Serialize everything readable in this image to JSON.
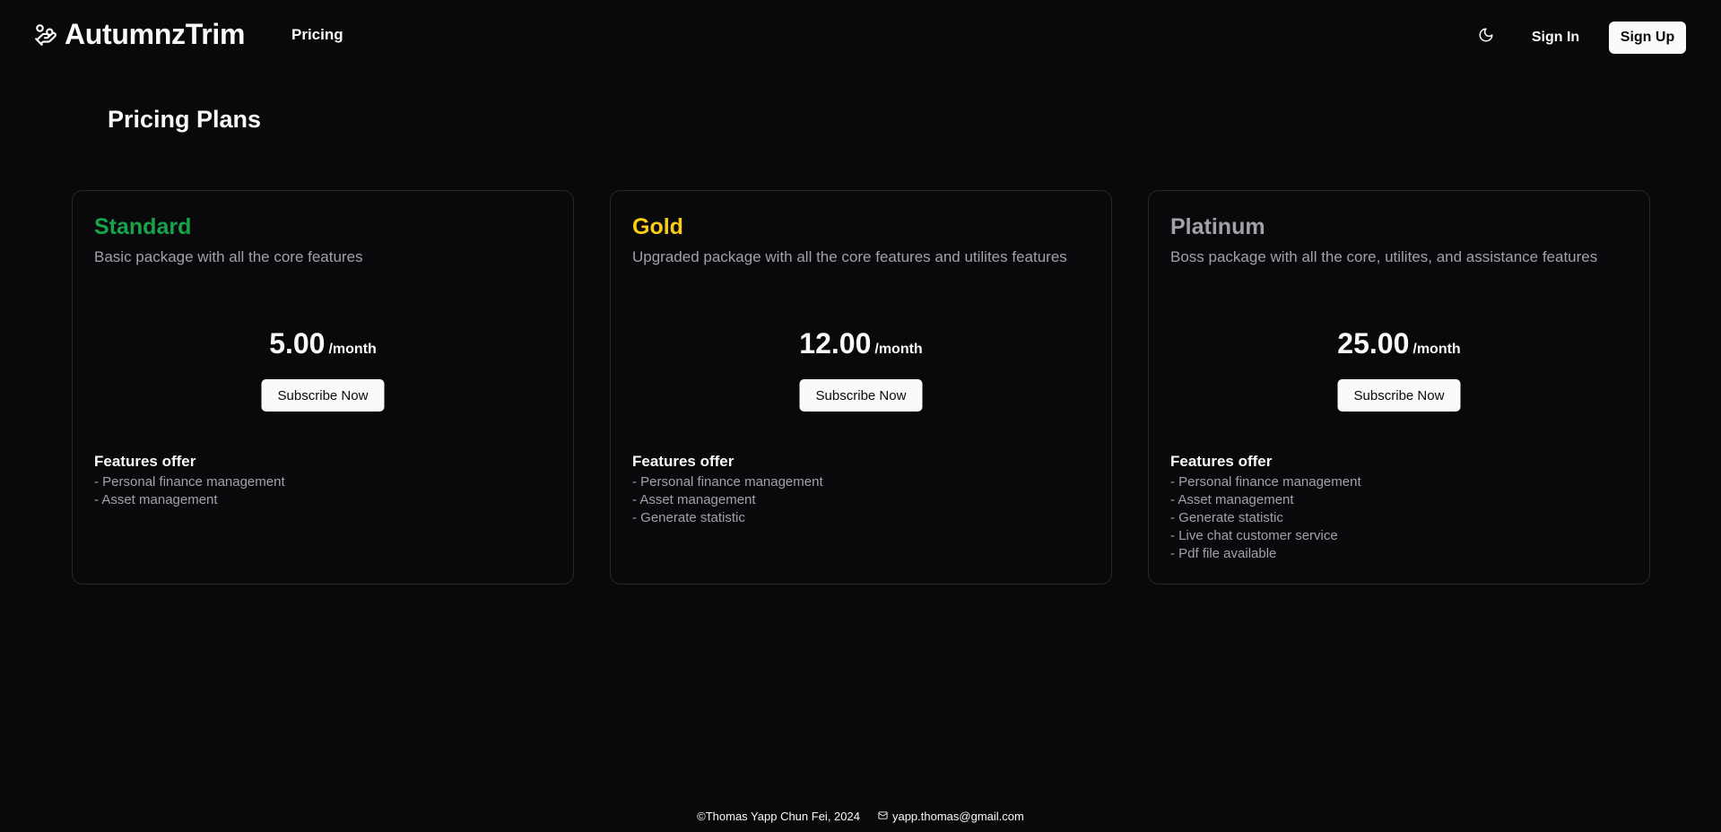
{
  "header": {
    "brand_name": "AutumnzTrim",
    "brand_icon": "hand-coins-icon",
    "nav_pricing": "Pricing",
    "theme_icon": "moon-icon",
    "sign_in": "Sign In",
    "sign_up": "Sign Up"
  },
  "main": {
    "title": "Pricing Plans",
    "plans": [
      {
        "name": "Standard",
        "color": "#16a34a",
        "description": "Basic package with all the core features",
        "price": "5.00",
        "period": "/month",
        "button": "Subscribe Now",
        "features_title": "Features offer",
        "features": [
          "- Personal finance management",
          "- Asset management"
        ]
      },
      {
        "name": "Gold",
        "color": "#facc15",
        "description": "Upgraded package with all the core features and utilites features",
        "price": "12.00",
        "period": "/month",
        "button": "Subscribe Now",
        "features_title": "Features offer",
        "features": [
          "- Personal finance management",
          "- Asset management",
          "- Generate statistic"
        ]
      },
      {
        "name": "Platinum",
        "color": "#a1a1aa",
        "description": "Boss package with all the core, utilites, and assistance features",
        "price": "25.00",
        "period": "/month",
        "button": "Subscribe Now",
        "features_title": "Features offer",
        "features": [
          "- Personal finance management",
          "- Asset management",
          "- Generate statistic",
          "- Live chat customer service",
          "- Pdf file available"
        ]
      }
    ]
  },
  "footer": {
    "copyright": "©Thomas Yapp Chun Fei, 2024",
    "email_icon": "mail-icon",
    "email": "yapp.thomas@gmail.com"
  }
}
